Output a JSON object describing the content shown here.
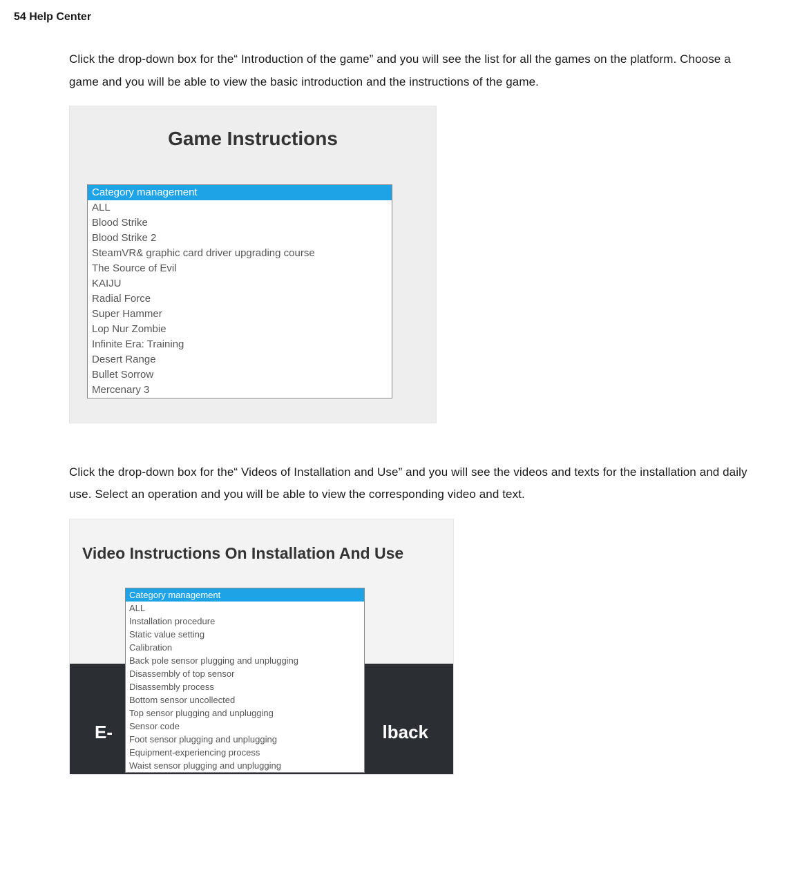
{
  "header": "54  Help Center",
  "para1": "Click the drop-down box for the“ Introduction of the game” and you will see the list for all the games on the platform. Choose a game and you will be able to view the basic introduction and the instructions of the game.",
  "shot1": {
    "title": "Game Instructions",
    "selected": "Category management",
    "items": [
      "ALL",
      "Blood Strike",
      "Blood Strike 2",
      "SteamVR& graphic card driver upgrading course",
      "The Source of Evil",
      "KAIJU",
      "Radial Force",
      "Super Hammer",
      "Lop Nur Zombie",
      "Infinite Era: Training",
      "Desert Range",
      "Bullet Sorrow",
      "Mercenary 3"
    ]
  },
  "para2": "Click the drop-down box for the“ Videos of Installation and Use” and you will see the videos and texts for the installation and daily use. Select an operation and you will be able to view the corresponding video and text.",
  "shot2": {
    "title": "Video Instructions On Installation And Use",
    "bg_left": "E-",
    "bg_right": "lback",
    "selected": "Category management",
    "items": [
      "ALL",
      "Installation procedure",
      "Static value setting",
      "Calibration",
      "Back pole sensor plugging and unplugging",
      "Disassembly of top sensor",
      "Disassembly process",
      "Bottom sensor uncollected",
      "Top sensor plugging and unplugging",
      "Sensor code",
      "Foot sensor plugging and unplugging",
      "Equipment-experiencing process",
      "Waist sensor plugging and unplugging"
    ]
  }
}
